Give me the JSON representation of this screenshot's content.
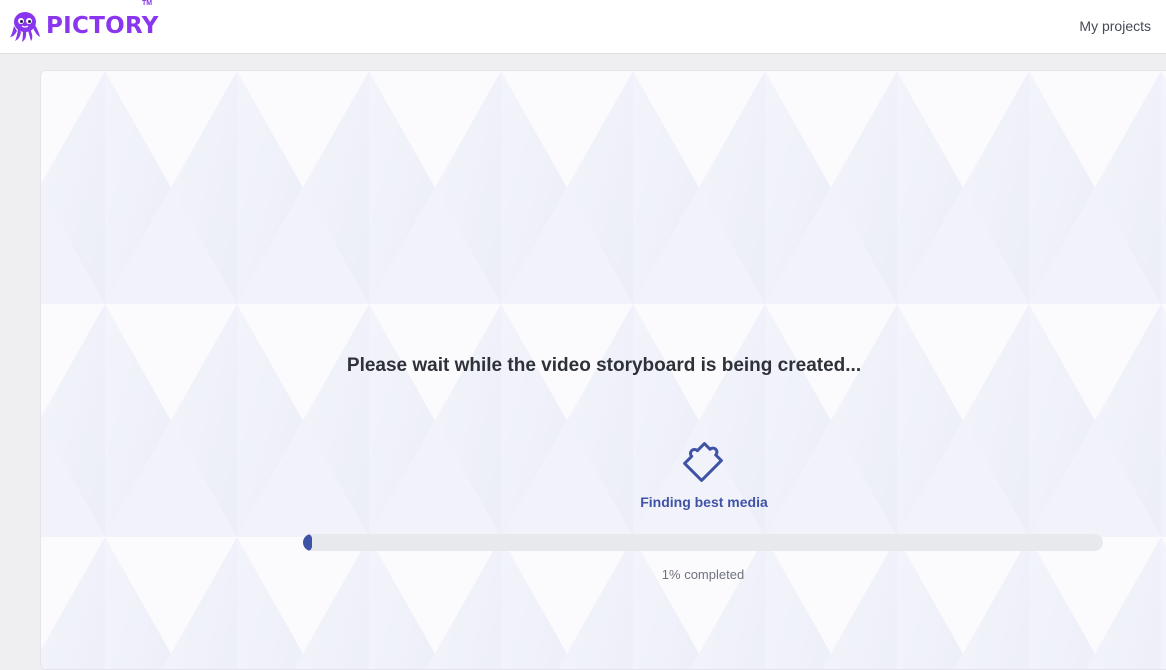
{
  "header": {
    "brand": "PICTORY",
    "trademark": "TM",
    "nav_link": "My projects",
    "brand_color": "#8a35f0"
  },
  "progress": {
    "title": "Please wait while the video storyboard is being created...",
    "step_label": "Finding best media",
    "step_icon": "puzzle-icon",
    "percent": 1,
    "caption": "1% completed",
    "accent_color": "#3f53a6"
  }
}
